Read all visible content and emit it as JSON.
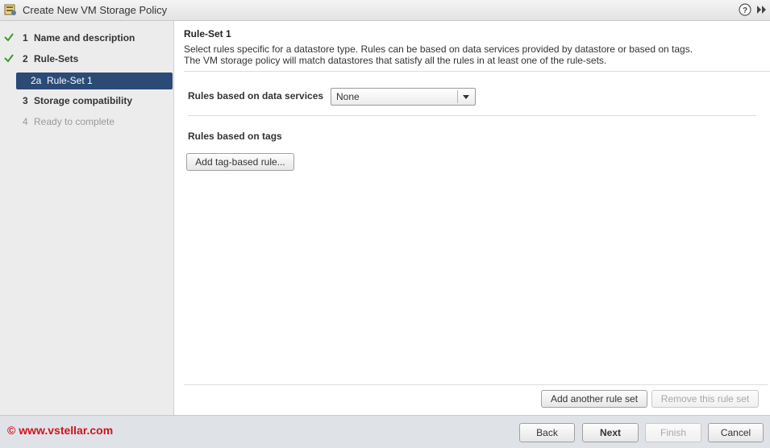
{
  "window": {
    "title": "Create New VM Storage Policy"
  },
  "steps": [
    {
      "num": "1",
      "label": "Name and description",
      "state": "done"
    },
    {
      "num": "2",
      "label": "Rule-Sets",
      "state": "done"
    },
    {
      "num": "2a",
      "label": "Rule-Set 1",
      "state": "active"
    },
    {
      "num": "3",
      "label": "Storage compatibility",
      "state": "normal"
    },
    {
      "num": "4",
      "label": "Ready to complete",
      "state": "disabled"
    }
  ],
  "main": {
    "title": "Rule-Set 1",
    "desc_line1": "Select rules specific for a datastore type. Rules can be based on data services provided by datastore or based on tags.",
    "desc_line2": "The VM storage policy will match datastores that satisfy all the rules in at least one of the rule-sets.",
    "services_label": "Rules based on data services",
    "services_value": "None",
    "tags_label": "Rules based on tags",
    "add_tag_button": "Add tag-based rule...",
    "add_ruleset_button": "Add another rule set",
    "remove_ruleset_button": "Remove this rule set"
  },
  "footer": {
    "copyright": "© www.vstellar.com",
    "back": "Back",
    "next": "Next",
    "finish": "Finish",
    "cancel": "Cancel"
  },
  "colors": {
    "accent": "#2b4a75",
    "check": "#3a9a2a",
    "copyright": "#d21414"
  },
  "icons": [
    "policy-app-icon",
    "help-icon",
    "expand-icon",
    "check-icon",
    "dropdown-arrow-icon"
  ]
}
